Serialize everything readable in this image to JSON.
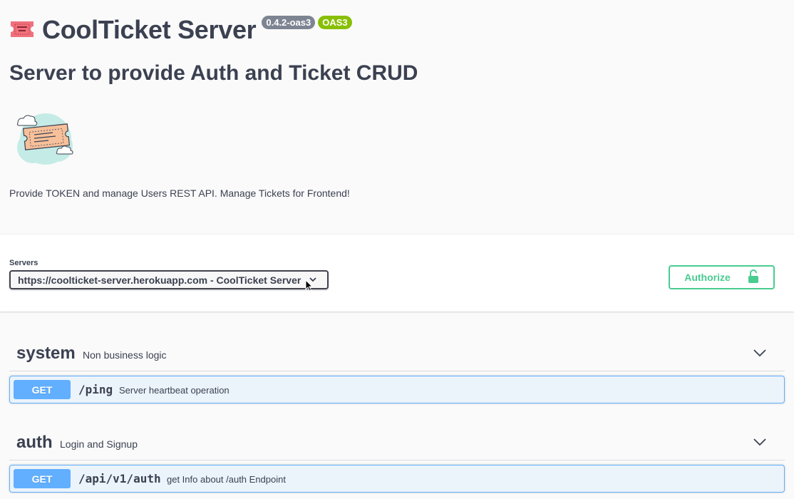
{
  "info": {
    "title": "CoolTicket Server",
    "version_badge": "0.4.2-oas3",
    "oas_badge": "OAS3",
    "subtitle": "Server to provide Auth and Ticket CRUD",
    "description": "Provide TOKEN and manage Users REST API. Manage Tickets for Frontend!",
    "title_icon": "admit-one-ticket-icon",
    "logo_icon": "ticket-cloud-logo"
  },
  "scheme": {
    "servers_label": "Servers",
    "selected_server": "https://coolticket-server.herokuapp.com - CoolTicket Server",
    "authorize_label": "Authorize",
    "authorize_icon": "unlocked-lock-icon"
  },
  "tags": [
    {
      "name": "system",
      "description": "Non business logic",
      "operations": [
        {
          "method": "GET",
          "path": "/ping",
          "summary": "Server heartbeat operation"
        }
      ]
    },
    {
      "name": "auth",
      "description": "Login and Signup",
      "operations": [
        {
          "method": "GET",
          "path": "/api/v1/auth",
          "summary": "get Info about /auth Endpoint"
        }
      ]
    }
  ],
  "colors": {
    "get_method": "#61affe",
    "get_background": "#ebf3fb",
    "authorize": "#49cc90",
    "version_badge": "#7d8492",
    "oas_badge": "#89bf04"
  }
}
